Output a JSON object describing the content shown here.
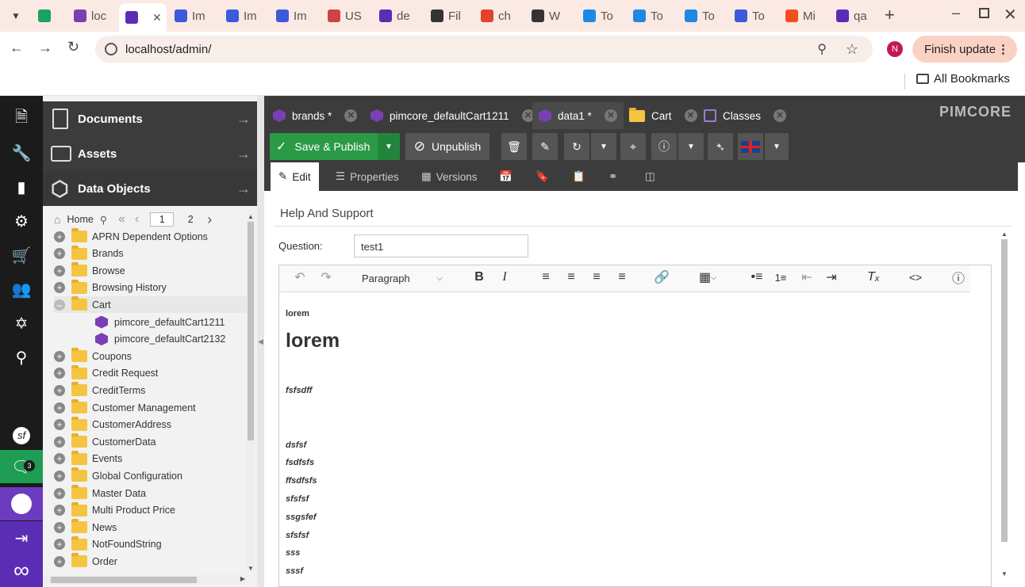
{
  "browser": {
    "tabs": [
      {
        "label": "",
        "color": "#1aa260"
      },
      {
        "label": "loc",
        "color": "#7b3fb5"
      },
      {
        "label": "",
        "color": "#5b2db5"
      },
      {
        "label": "Im",
        "color": "#3b5bdb"
      },
      {
        "label": "Im",
        "color": "#3b5bdb"
      },
      {
        "label": "Im",
        "color": "#3b5bdb"
      },
      {
        "label": "US",
        "color": "#c44"
      },
      {
        "label": "de",
        "color": "#5b2db5"
      },
      {
        "label": "Fil",
        "color": "#333"
      },
      {
        "label": "ch",
        "color": "#e24329"
      },
      {
        "label": "W",
        "color": "#333"
      },
      {
        "label": "To",
        "color": "#1e88e5"
      },
      {
        "label": "To",
        "color": "#1e88e5"
      },
      {
        "label": "To",
        "color": "#1e88e5"
      },
      {
        "label": "To",
        "color": "#3b5bdb"
      },
      {
        "label": "Mi",
        "color": "#f24e1e"
      },
      {
        "label": "qa",
        "color": "#5b2db5"
      }
    ],
    "url": "localhost/admin/",
    "profile_initial": "N",
    "update_label": "Finish update",
    "bookmarks_label": "All Bookmarks"
  },
  "sidebar": {
    "badge": "3"
  },
  "tree": {
    "sections": [
      "Documents",
      "Assets",
      "Data Objects"
    ],
    "home_label": "Home",
    "pages": [
      "1",
      "2"
    ],
    "items": [
      {
        "label": "APRN Dependent Options",
        "type": "folder"
      },
      {
        "label": "Brands",
        "type": "folder"
      },
      {
        "label": "Browse",
        "type": "folder"
      },
      {
        "label": "Browsing History",
        "type": "folder"
      },
      {
        "label": "Cart",
        "type": "folder-open"
      },
      {
        "label": "pimcore_defaultCart1211",
        "type": "object"
      },
      {
        "label": "pimcore_defaultCart2132",
        "type": "object"
      },
      {
        "label": "Coupons",
        "type": "folder"
      },
      {
        "label": "Credit Request",
        "type": "folder"
      },
      {
        "label": "CreditTerms",
        "type": "folder"
      },
      {
        "label": "Customer Management",
        "type": "folder"
      },
      {
        "label": "CustomerAddress",
        "type": "folder"
      },
      {
        "label": "CustomerData",
        "type": "folder"
      },
      {
        "label": "Events",
        "type": "folder"
      },
      {
        "label": "Global Configuration",
        "type": "folder"
      },
      {
        "label": "Master Data",
        "type": "folder"
      },
      {
        "label": "Multi Product Price",
        "type": "folder"
      },
      {
        "label": "News",
        "type": "folder"
      },
      {
        "label": "NotFoundString",
        "type": "folder"
      },
      {
        "label": "Order",
        "type": "folder"
      }
    ]
  },
  "main": {
    "logo": "PIMCORE",
    "tabs": [
      {
        "label": "brands *",
        "icon": "cube"
      },
      {
        "label": "pimcore_defaultCart1211",
        "icon": "cube"
      },
      {
        "label": "data1 *",
        "icon": "cube"
      },
      {
        "label": "Cart",
        "icon": "folder"
      },
      {
        "label": "Classes",
        "icon": "classes"
      }
    ],
    "save_publish": "Save & Publish",
    "unpublish": "Unpublish",
    "subtabs": [
      "Edit",
      "Properties",
      "Versions"
    ],
    "panel_title": "Help And Support",
    "question_label": "Question:",
    "question_value": "test1",
    "format_select": "Paragraph",
    "content": {
      "small": "lorem",
      "heading": "lorem",
      "lines": [
        "fsfsdff",
        "dsfsf",
        "fsdfsfs",
        "ffsdfsfs",
        "sfsfsf",
        "ssgsfef",
        "sfsfsf",
        "sss",
        "sssf"
      ]
    }
  }
}
